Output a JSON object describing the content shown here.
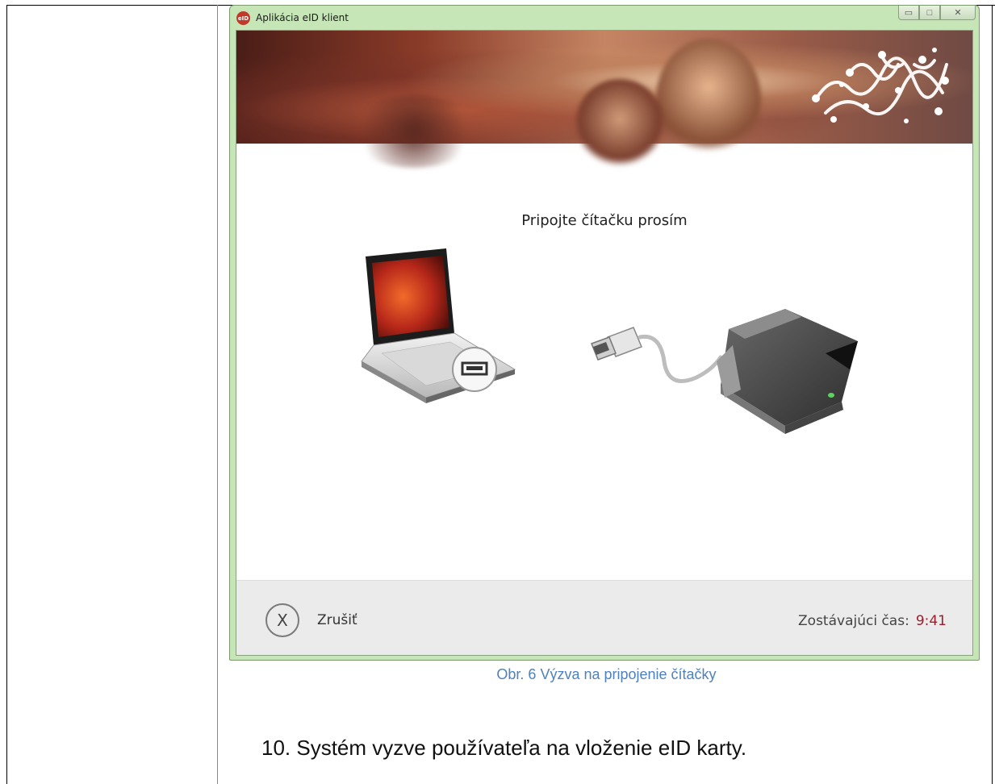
{
  "window": {
    "icon_text": "eID",
    "title": "Aplikácia eID klient",
    "controls": {
      "minimize": "▭",
      "maximize": "□",
      "close": "✕"
    }
  },
  "banner": {
    "logo_icon": "swirl-logo-icon"
  },
  "main": {
    "prompt": "Pripojte čítačku prosím",
    "illustration": {
      "items": [
        "laptop-icon",
        "usb-port-icon",
        "usb-cable-icon",
        "card-reader-icon"
      ]
    }
  },
  "footer": {
    "cancel_icon": "X",
    "cancel_label": "Zrušiť",
    "timer_label": "Zostávajúci čas:",
    "timer_value": "9:41"
  },
  "document": {
    "caption": "Obr. 6 Výzva na pripojenie čítačky",
    "step_text": "10. Systém vyzve používateľa na vloženie eID karty."
  },
  "colors": {
    "caption": "#4f81bd",
    "timer": "#a01c2b",
    "window_frame": "#c7e6b8"
  }
}
